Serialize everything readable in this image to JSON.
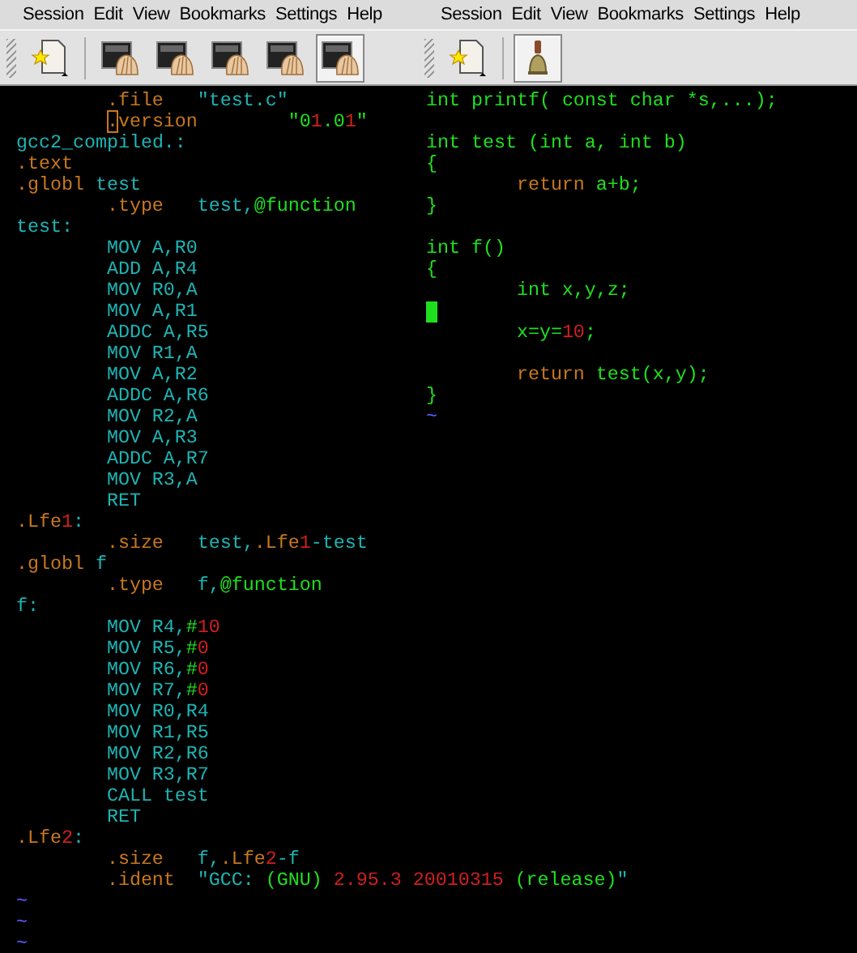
{
  "windows": [
    {
      "menu": [
        "Session",
        "Edit",
        "View",
        "Bookmarks",
        "Settings",
        "Help"
      ],
      "tabs": [
        {
          "kind": "shell",
          "selected": false
        },
        {
          "kind": "shell",
          "selected": false
        },
        {
          "kind": "shell",
          "selected": false
        },
        {
          "kind": "shell",
          "selected": false
        },
        {
          "kind": "shell",
          "selected": true
        }
      ],
      "lines": [
        {
          "kind": "code",
          "indent": true,
          "cursor": false,
          "segments": [
            {
              "text": ".file\t",
              "color": "#c8781e"
            },
            {
              "text": "\"test.c\"",
              "color": "#1eb4b4"
            }
          ]
        },
        {
          "kind": "code",
          "indent": true,
          "cursor": true,
          "segments": [
            {
              "text": ".version\t",
              "color": "#c8781e"
            },
            {
              "text": "\"0",
              "color": "#1ee01e"
            },
            {
              "text": "1",
              "color": "#d21e1e"
            },
            {
              "text": ".0",
              "color": "#1ee01e"
            },
            {
              "text": "1",
              "color": "#d21e1e"
            },
            {
              "text": "\"",
              "color": "#1ee01e"
            }
          ]
        },
        {
          "kind": "code",
          "indent": false,
          "cursor": false,
          "segments": [
            {
              "text": "gcc2_compiled.:",
              "color": "#1eb4b4"
            }
          ]
        },
        {
          "kind": "code",
          "indent": false,
          "cursor": false,
          "segments": [
            {
              "text": ".text",
              "color": "#c8781e"
            }
          ]
        },
        {
          "kind": "code",
          "indent": false,
          "cursor": false,
          "segments": [
            {
              "text": ".globl",
              "color": "#c8781e"
            },
            {
              "text": " test",
              "color": "#1eb4b4"
            }
          ]
        },
        {
          "kind": "code",
          "indent": true,
          "cursor": false,
          "segments": [
            {
              "text": ".type\t",
              "color": "#c8781e"
            },
            {
              "text": "test,",
              "color": "#1eb4b4"
            },
            {
              "text": "@function",
              "color": "#1ee01e"
            }
          ]
        },
        {
          "kind": "code",
          "indent": false,
          "cursor": false,
          "segments": [
            {
              "text": "test:",
              "color": "#1eb4b4"
            }
          ]
        },
        {
          "kind": "code",
          "indent": true,
          "cursor": false,
          "segments": [
            {
              "text": "MOV A,R0",
              "color": "#1eb4b4"
            }
          ]
        },
        {
          "kind": "code",
          "indent": true,
          "cursor": false,
          "segments": [
            {
              "text": "ADD A,R4",
              "color": "#1eb4b4"
            }
          ]
        },
        {
          "kind": "code",
          "indent": true,
          "cursor": false,
          "segments": [
            {
              "text": "MOV R0,A",
              "color": "#1eb4b4"
            }
          ]
        },
        {
          "kind": "code",
          "indent": true,
          "cursor": false,
          "segments": [
            {
              "text": "MOV A,R1",
              "color": "#1eb4b4"
            }
          ]
        },
        {
          "kind": "code",
          "indent": true,
          "cursor": false,
          "segments": [
            {
              "text": "ADDC A,R5",
              "color": "#1eb4b4"
            }
          ]
        },
        {
          "kind": "code",
          "indent": true,
          "cursor": false,
          "segments": [
            {
              "text": "MOV R1,A",
              "color": "#1eb4b4"
            }
          ]
        },
        {
          "kind": "code",
          "indent": true,
          "cursor": false,
          "segments": [
            {
              "text": "MOV A,R2",
              "color": "#1eb4b4"
            }
          ]
        },
        {
          "kind": "code",
          "indent": true,
          "cursor": false,
          "segments": [
            {
              "text": "ADDC A,R6",
              "color": "#1eb4b4"
            }
          ]
        },
        {
          "kind": "code",
          "indent": true,
          "cursor": false,
          "segments": [
            {
              "text": "MOV R2,A",
              "color": "#1eb4b4"
            }
          ]
        },
        {
          "kind": "code",
          "indent": true,
          "cursor": false,
          "segments": [
            {
              "text": "MOV A,R3",
              "color": "#1eb4b4"
            }
          ]
        },
        {
          "kind": "code",
          "indent": true,
          "cursor": false,
          "segments": [
            {
              "text": "ADDC A,R7",
              "color": "#1eb4b4"
            }
          ]
        },
        {
          "kind": "code",
          "indent": true,
          "cursor": false,
          "segments": [
            {
              "text": "MOV R3,A",
              "color": "#1eb4b4"
            }
          ]
        },
        {
          "kind": "code",
          "indent": true,
          "cursor": false,
          "segments": [
            {
              "text": "RET",
              "color": "#1eb4b4"
            }
          ]
        },
        {
          "kind": "code",
          "indent": false,
          "cursor": false,
          "segments": [
            {
              "text": ".Lfe",
              "color": "#c8781e"
            },
            {
              "text": "1",
              "color": "#d21e1e"
            },
            {
              "text": ":",
              "color": "#1eb4b4"
            }
          ]
        },
        {
          "kind": "code",
          "indent": true,
          "cursor": false,
          "segments": [
            {
              "text": ".size\t",
              "color": "#c8781e"
            },
            {
              "text": "test,",
              "color": "#1eb4b4"
            },
            {
              "text": ".Lfe",
              "color": "#c8781e"
            },
            {
              "text": "1",
              "color": "#d21e1e"
            },
            {
              "text": "-test",
              "color": "#1eb4b4"
            }
          ]
        },
        {
          "kind": "code",
          "indent": false,
          "cursor": false,
          "segments": [
            {
              "text": ".globl",
              "color": "#c8781e"
            },
            {
              "text": " f",
              "color": "#1eb4b4"
            }
          ]
        },
        {
          "kind": "code",
          "indent": true,
          "cursor": false,
          "segments": [
            {
              "text": ".type\t",
              "color": "#c8781e"
            },
            {
              "text": "f,",
              "color": "#1eb4b4"
            },
            {
              "text": "@function",
              "color": "#1ee01e"
            }
          ]
        },
        {
          "kind": "code",
          "indent": false,
          "cursor": false,
          "segments": [
            {
              "text": "f:",
              "color": "#1eb4b4"
            }
          ]
        },
        {
          "kind": "code",
          "indent": true,
          "cursor": false,
          "segments": [
            {
              "text": "MOV R4,",
              "color": "#1eb4b4"
            },
            {
              "text": "#",
              "color": "#1ee01e"
            },
            {
              "text": "10",
              "color": "#d21e1e"
            }
          ]
        },
        {
          "kind": "code",
          "indent": true,
          "cursor": false,
          "segments": [
            {
              "text": "MOV R5,",
              "color": "#1eb4b4"
            },
            {
              "text": "#",
              "color": "#1ee01e"
            },
            {
              "text": "0",
              "color": "#d21e1e"
            }
          ]
        },
        {
          "kind": "code",
          "indent": true,
          "cursor": false,
          "segments": [
            {
              "text": "MOV R6,",
              "color": "#1eb4b4"
            },
            {
              "text": "#",
              "color": "#1ee01e"
            },
            {
              "text": "0",
              "color": "#d21e1e"
            }
          ]
        },
        {
          "kind": "code",
          "indent": true,
          "cursor": false,
          "segments": [
            {
              "text": "MOV R7,",
              "color": "#1eb4b4"
            },
            {
              "text": "#",
              "color": "#1ee01e"
            },
            {
              "text": "0",
              "color": "#d21e1e"
            }
          ]
        },
        {
          "kind": "code",
          "indent": true,
          "cursor": false,
          "segments": [
            {
              "text": "MOV R0,R4",
              "color": "#1eb4b4"
            }
          ]
        },
        {
          "kind": "code",
          "indent": true,
          "cursor": false,
          "segments": [
            {
              "text": "MOV R1,R5",
              "color": "#1eb4b4"
            }
          ]
        },
        {
          "kind": "code",
          "indent": true,
          "cursor": false,
          "segments": [
            {
              "text": "MOV R2,R6",
              "color": "#1eb4b4"
            }
          ]
        },
        {
          "kind": "code",
          "indent": true,
          "cursor": false,
          "segments": [
            {
              "text": "MOV R3,R7",
              "color": "#1eb4b4"
            }
          ]
        },
        {
          "kind": "code",
          "indent": true,
          "cursor": false,
          "segments": [
            {
              "text": "CALL test",
              "color": "#1eb4b4"
            }
          ]
        },
        {
          "kind": "code",
          "indent": true,
          "cursor": false,
          "segments": [
            {
              "text": "RET",
              "color": "#1eb4b4"
            }
          ]
        },
        {
          "kind": "code",
          "indent": false,
          "cursor": false,
          "segments": [
            {
              "text": ".Lfe",
              "color": "#c8781e"
            },
            {
              "text": "2",
              "color": "#d21e1e"
            },
            {
              "text": ":",
              "color": "#1eb4b4"
            }
          ]
        },
        {
          "kind": "code",
          "indent": true,
          "cursor": false,
          "segments": [
            {
              "text": ".size\t",
              "color": "#c8781e"
            },
            {
              "text": "f,",
              "color": "#1eb4b4"
            },
            {
              "text": ".Lfe",
              "color": "#c8781e"
            },
            {
              "text": "2",
              "color": "#d21e1e"
            },
            {
              "text": "-f",
              "color": "#1eb4b4"
            }
          ]
        },
        {
          "kind": "code",
          "indent": true,
          "cursor": false,
          "segments": [
            {
              "text": ".ident\t",
              "color": "#c8781e"
            },
            {
              "text": "\"GCC: ",
              "color": "#1eb4b4"
            },
            {
              "text": "(GNU)",
              "color": "#1ee01e"
            },
            {
              "text": " 2.95.3 20010315 ",
              "color": "#d21e1e"
            },
            {
              "text": "(release)",
              "color": "#1ee01e"
            },
            {
              "text": "\"",
              "color": "#1eb4b4"
            }
          ]
        },
        {
          "kind": "code",
          "indent": false,
          "cursor": false,
          "segments": [
            {
              "text": "~",
              "color": "#5a5aff"
            }
          ]
        },
        {
          "kind": "code",
          "indent": false,
          "cursor": false,
          "segments": [
            {
              "text": "~",
              "color": "#5a5aff"
            }
          ]
        },
        {
          "kind": "code",
          "indent": false,
          "cursor": false,
          "segments": [
            {
              "text": "~",
              "color": "#5a5aff"
            }
          ]
        }
      ]
    },
    {
      "menu": [
        "Session",
        "Edit",
        "View",
        "Bookmarks",
        "Settings",
        "Help"
      ],
      "tabs": [
        {
          "kind": "bell",
          "selected": true
        }
      ],
      "lines": [
        {
          "kind": "code",
          "indent": false,
          "cursor": false,
          "segments": [
            {
              "text": "int printf( const char *s,...);",
              "color": "#1ee01e"
            }
          ]
        },
        {
          "kind": "blank",
          "cursor": false
        },
        {
          "kind": "code",
          "indent": false,
          "cursor": false,
          "segments": [
            {
              "text": "int test (int a, int b)",
              "color": "#1ee01e"
            }
          ]
        },
        {
          "kind": "code",
          "indent": false,
          "cursor": false,
          "segments": [
            {
              "text": "{",
              "color": "#1ee01e"
            }
          ]
        },
        {
          "kind": "code",
          "indent": true,
          "cursor": false,
          "segments": [
            {
              "text": "return",
              "color": "#c8781e"
            },
            {
              "text": " a+b;",
              "color": "#1ee01e"
            }
          ]
        },
        {
          "kind": "code",
          "indent": false,
          "cursor": false,
          "segments": [
            {
              "text": "}",
              "color": "#1ee01e"
            }
          ]
        },
        {
          "kind": "blank",
          "cursor": false
        },
        {
          "kind": "code",
          "indent": false,
          "cursor": false,
          "segments": [
            {
              "text": "int f()",
              "color": "#1ee01e"
            }
          ]
        },
        {
          "kind": "code",
          "indent": false,
          "cursor": false,
          "segments": [
            {
              "text": "{",
              "color": "#1ee01e"
            }
          ]
        },
        {
          "kind": "code",
          "indent": true,
          "cursor": false,
          "segments": [
            {
              "text": "int x,y,z;",
              "color": "#1ee01e"
            }
          ]
        },
        {
          "kind": "blank",
          "cursor": true
        },
        {
          "kind": "code",
          "indent": true,
          "cursor": false,
          "segments": [
            {
              "text": "x=y=",
              "color": "#1ee01e"
            },
            {
              "text": "10",
              "color": "#d21e1e"
            },
            {
              "text": ";",
              "color": "#1ee01e"
            }
          ]
        },
        {
          "kind": "blank",
          "cursor": false
        },
        {
          "kind": "code",
          "indent": true,
          "cursor": false,
          "segments": [
            {
              "text": "return",
              "color": "#c8781e"
            },
            {
              "text": " test(x,y);",
              "color": "#1ee01e"
            }
          ]
        },
        {
          "kind": "code",
          "indent": false,
          "cursor": false,
          "segments": [
            {
              "text": "}",
              "color": "#1ee01e"
            }
          ]
        },
        {
          "kind": "code",
          "indent": false,
          "cursor": false,
          "segments": [
            {
              "text": "~",
              "color": "#5a5aff"
            }
          ]
        }
      ]
    }
  ]
}
